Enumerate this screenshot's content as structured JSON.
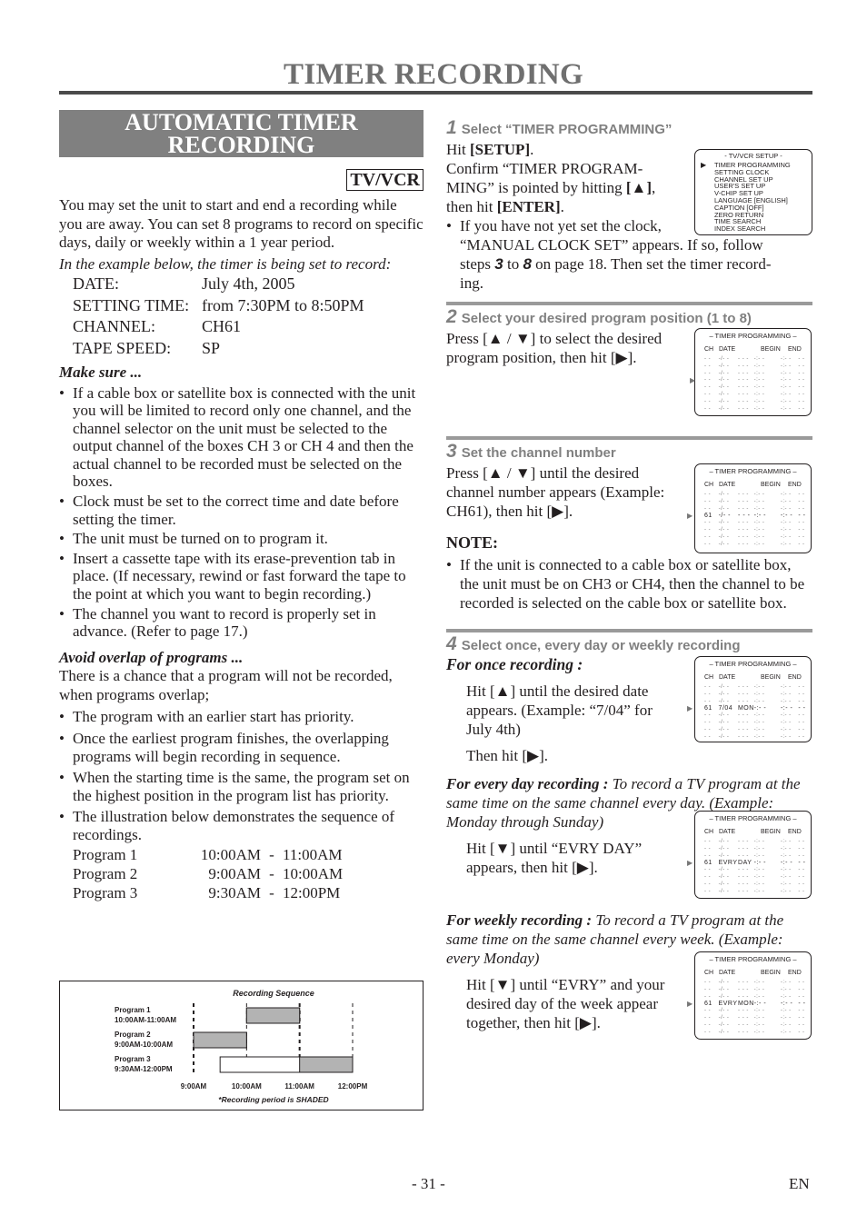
{
  "page": {
    "title": "TIMER RECORDING",
    "page_number": "- 31 -",
    "language": "EN"
  },
  "left": {
    "section_title_line1": "AUTOMATIC TIMER",
    "section_title_line2": "RECORDING",
    "badge": "TV/VCR",
    "intro": "You may set the unit to start and end a recording while you are away. You can set 8 programs to record on specific days, daily or weekly within a 1 year period.",
    "example_intro": "In the example below, the timer is being set to record:",
    "example": [
      {
        "key": "DATE:",
        "value": "July 4th, 2005"
      },
      {
        "key": "SETTING TIME:",
        "value": "from 7:30PM to 8:50PM"
      },
      {
        "key": "CHANNEL:",
        "value": "CH61"
      },
      {
        "key": "TAPE SPEED:",
        "value": "SP"
      }
    ],
    "make_sure_title": "Make sure ...",
    "make_sure": [
      "If a cable box or satellite box is connected with the unit you will be limited to record only one channel, and the channel selector on the unit must be selected to the output channel of the boxes CH 3 or CH 4 and then the actual channel to be recorded must be selected on the boxes.",
      "Clock must be set to the correct time and date before setting the timer.",
      "The unit must be turned on to program it.",
      "Insert a cassette tape with its erase-prevention tab in place. (If necessary, rewind or fast forward the tape to the point at which you want to begin recording.)",
      "The channel you want to record is properly set in advance. (Refer to page 17.)"
    ],
    "overlap_title": "Avoid overlap of programs ...",
    "overlap_intro": "There is a chance that a program will not be recorded, when programs overlap;",
    "overlap": [
      "The program with an earlier start has priority.",
      "Once the earliest program finishes, the overlapping programs will begin recording in sequence.",
      "When the starting time is the same, the program set on the highest position in the program list has priority.",
      "The illustration below demonstrates the sequence of recordings."
    ],
    "programs": [
      {
        "name": "Program 1",
        "start": "10:00AM",
        "end": "11:00AM"
      },
      {
        "name": "Program 2",
        "start": "9:00AM",
        "end": "10:00AM"
      },
      {
        "name": "Program 3",
        "start": "9:30AM",
        "end": "12:00PM"
      }
    ]
  },
  "chart_data": {
    "type": "gantt",
    "title": "Recording Sequence",
    "footnote": "*Recording period is SHADED",
    "x_ticks": [
      "9:00AM",
      "10:00AM",
      "11:00AM",
      "12:00PM"
    ],
    "x_range_hours": [
      9,
      12
    ],
    "series": [
      {
        "label": "Program 1",
        "sublabel": "10:00AM-11:00AM",
        "start": 10,
        "end": 11,
        "recorded": [
          [
            10,
            11
          ]
        ]
      },
      {
        "label": "Program 2",
        "sublabel": "9:00AM-10:00AM",
        "start": 9,
        "end": 10,
        "recorded": [
          [
            9,
            10
          ]
        ]
      },
      {
        "label": "Program 3",
        "sublabel": "9:30AM-12:00PM",
        "start": 9.5,
        "end": 12,
        "recorded": [
          [
            11,
            12
          ]
        ]
      }
    ],
    "colors": {
      "shaded": "#b3b3b3",
      "unshaded": "#ffffff"
    }
  },
  "steps": {
    "s1": {
      "num": "1",
      "title": "Select “TIMER PROGRAMMING”",
      "l1_pre": "Hit ",
      "l1_b": "[SETUP]",
      "l1_post": ".",
      "l2": "Confirm “TIMER PROGRAM-",
      "l3_pre": "MING” is pointed by hitting ",
      "l3_b": "[▲]",
      "l3_post": ",",
      "l4_pre": "then hit ",
      "l4_b": "[ENTER]",
      "l4_post": ".",
      "bullet_l1": "If you have not yet set the clock,",
      "bullet_l2": "“MANUAL CLOCK SET” appears. If so, follow",
      "bullet_l3_pre": "steps ",
      "bullet_l3_n1": "3",
      "bullet_l3_mid": " to ",
      "bullet_l3_n2": "8",
      "bullet_l3_post": " on page 18. Then set the timer record-",
      "bullet_l4": "ing.",
      "osd": {
        "title": "- TV/VCR SETUP -",
        "selected": 0,
        "items": [
          "TIMER PROGRAMMING",
          "SETTING CLOCK",
          "CHANNEL SET UP",
          "USER'S SET UP",
          "V-CHIP SET UP",
          "LANGUAGE  [ENGLISH]",
          "CAPTION  [OFF]",
          "ZERO RETURN",
          "TIME SEARCH",
          "INDEX SEARCH"
        ]
      }
    },
    "s2": {
      "num": "2",
      "title": "Select your desired program position (1 to 8)",
      "l1": "Press [▲ / ▼] to select the desired",
      "l2": "program position, then hit [▶]."
    },
    "s3": {
      "num": "3",
      "title": "Set the channel number",
      "l1": "Press [▲ / ▼] until the desired",
      "l2": "channel number appears (Example:",
      "l3": "CH61), then hit [▶].",
      "note_title": "NOTE:",
      "note": "If the unit is connected to a cable box or satellite box, the unit must be on CH3 or CH4, then the channel to be recorded is selected on the cable box or satellite box."
    },
    "s4": {
      "num": "4",
      "title": "Select once, every day or weekly recording",
      "once_title": "For once recording :",
      "once_l1": "Hit [▲] until the desired date",
      "once_l2": "appears. (Example: “7/04” for",
      "once_l3": "July 4th)",
      "once_l4": "Then hit [▶].",
      "daily_title": "For every day recording :",
      "daily_desc": " To record a TV program at the same time on the same channel every day. (Example: Monday through Sunday)",
      "daily_l1": "Hit [▼] until “EVRY DAY”",
      "daily_l2": "appears, then hit [▶].",
      "weekly_title": "For weekly recording :",
      "weekly_desc": " To record a TV program at the same time on the same channel every week. (Example: every Monday)",
      "weekly_l1": "Hit [▼] until “EVRY” and your",
      "weekly_l2": "desired day of the week appear",
      "weekly_l3": "together, then hit [▶]."
    }
  },
  "timer_osd": {
    "title": "– TIMER PROGRAMMING –",
    "headers": [
      "CH",
      "DATE",
      "BEGIN",
      "END"
    ],
    "blank_row": [
      "- -",
      "-/- -",
      "- - -",
      "-:- -",
      "-:- -",
      "- -"
    ],
    "screens": [
      {
        "highlight_row": 3,
        "ch": "",
        "date": "",
        "day": ""
      },
      {
        "highlight_row": 3,
        "ch": "61",
        "date": "",
        "day": ""
      },
      {
        "highlight_row": 3,
        "ch": "61",
        "date": "7/04",
        "day": "MON"
      },
      {
        "highlight_row": 3,
        "ch": "61",
        "date": "EVRY",
        "day": "DAY"
      },
      {
        "highlight_row": 3,
        "ch": "61",
        "date": "EVRY",
        "day": "MON"
      }
    ]
  }
}
